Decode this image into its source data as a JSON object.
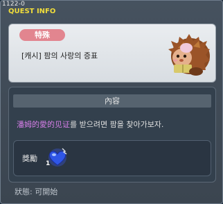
{
  "quest_id": "1122-0",
  "window_title": "QUEST INFO",
  "category_badge": "特殊",
  "quest_name": "[캐시] 팜의 사랑의 증표",
  "npc_icon": "hedgehog-npc-icon",
  "content_header": "內容",
  "description": {
    "highlight": "潘姆的愛的见证",
    "rest": "를 받으려면 팜을 찾아가보자."
  },
  "reward": {
    "label": "獎勵",
    "item_icon": "blue-heart-icon",
    "count": "1"
  },
  "status_text": "狀態:  可開始",
  "colors": {
    "title": "#f2de3a",
    "badge": "#e2858f",
    "highlight": "#d67ee8",
    "window_bg": "#414c58"
  }
}
